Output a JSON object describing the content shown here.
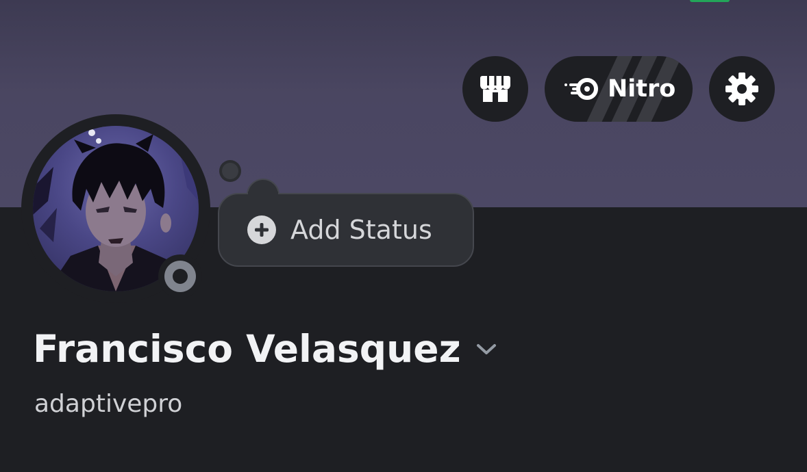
{
  "header": {
    "shop_icon": "shop-icon",
    "nitro_icon": "nitro-icon",
    "nitro_label": "Nitro",
    "settings_icon": "gear-icon"
  },
  "status": {
    "icon": "plus-circle-icon",
    "label": "Add Status",
    "presence": "offline"
  },
  "profile": {
    "display_name": "Francisco Velasquez",
    "username": "adaptivepro",
    "dropdown_icon": "chevron-down-icon"
  },
  "colors": {
    "banner": "#4a4661",
    "background": "#1e1f23",
    "offline_status": "#80848e",
    "accent_green": "#23a559"
  }
}
